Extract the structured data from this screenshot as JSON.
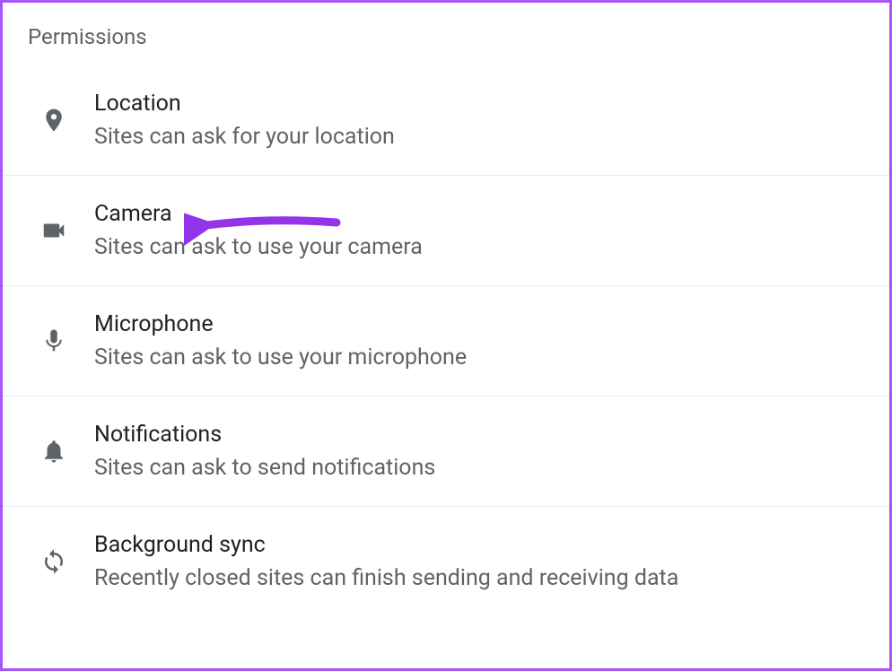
{
  "header": "Permissions",
  "items": [
    {
      "title": "Location",
      "desc": "Sites can ask for your location",
      "icon": "location"
    },
    {
      "title": "Camera",
      "desc": "Sites can ask to use your camera",
      "icon": "camera"
    },
    {
      "title": "Microphone",
      "desc": "Sites can ask to use your microphone",
      "icon": "microphone"
    },
    {
      "title": "Notifications",
      "desc": "Sites can ask to send notifications",
      "icon": "notifications"
    },
    {
      "title": "Background sync",
      "desc": "Recently closed sites can finish sending and receiving data",
      "icon": "sync"
    }
  ],
  "annotation": {
    "arrow_color": "#9333ea",
    "target": "Camera"
  }
}
